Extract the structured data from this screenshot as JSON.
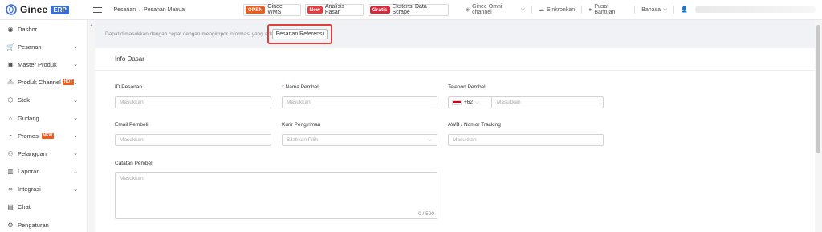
{
  "app": {
    "logo_text": "Ginee",
    "logo_badge": "ERP"
  },
  "breadcrumb": {
    "parent": "Pesanan",
    "separator": "/",
    "current": "Pesanan Manual"
  },
  "promos": [
    {
      "tag": "OPEN",
      "label": "Ginee WMS"
    },
    {
      "tag": "New",
      "label": "Analisis Pasar"
    },
    {
      "tag": "Gratis",
      "label": "Ekstensi Data Scrape"
    }
  ],
  "topnav": {
    "omni": "Ginee Omni channel",
    "sync": "Sinkronkan",
    "help": "Pusat Bantuan",
    "language": "Bahasa"
  },
  "sidebar": {
    "items": [
      {
        "label": "Dasbor",
        "icon": "dashboard-icon"
      },
      {
        "label": "Pesanan",
        "icon": "cart-icon"
      },
      {
        "label": "Master Produk",
        "icon": "box-icon"
      },
      {
        "label": "Produk Channel",
        "icon": "channel-icon",
        "badge": "HOT"
      },
      {
        "label": "Stok",
        "icon": "stock-icon"
      },
      {
        "label": "Gudang",
        "icon": "warehouse-icon"
      },
      {
        "label": "Promosi",
        "icon": "promo-icon",
        "badge": "NEW"
      },
      {
        "label": "Pelanggan",
        "icon": "users-icon"
      },
      {
        "label": "Laporan",
        "icon": "chart-icon"
      },
      {
        "label": "Integrasi",
        "icon": "link-icon"
      },
      {
        "label": "Chat",
        "icon": "chat-icon"
      },
      {
        "label": "Pengaturan",
        "icon": "gear-icon"
      }
    ]
  },
  "main": {
    "info_text": "Dapat dimasukkan dengan cepat dengan mengimpor informasi yang ada",
    "ref_button": "Pesanan Referensi",
    "card_title": "Info Dasar",
    "fields": {
      "order_id": {
        "label": "ID Pesanan",
        "placeholder": "Masukkan"
      },
      "buyer_name": {
        "label": "Nama Pembeli",
        "placeholder": "Masukkan",
        "required_mark": "*"
      },
      "buyer_phone": {
        "label": "Telepon Pembeli",
        "prefix": "+62",
        "placeholder": "Masukkan"
      },
      "buyer_email": {
        "label": "Email Pembeli",
        "placeholder": "Masukkan"
      },
      "courier": {
        "label": "Kurir Pengiriman",
        "placeholder": "Silahkan Pilih"
      },
      "awb": {
        "label": "AWB / Nomor Tracking",
        "placeholder": "Masukkan"
      },
      "notes": {
        "label": "Catatan Pembeli",
        "placeholder": "Masukkan",
        "counter": "0 / 500"
      }
    }
  }
}
